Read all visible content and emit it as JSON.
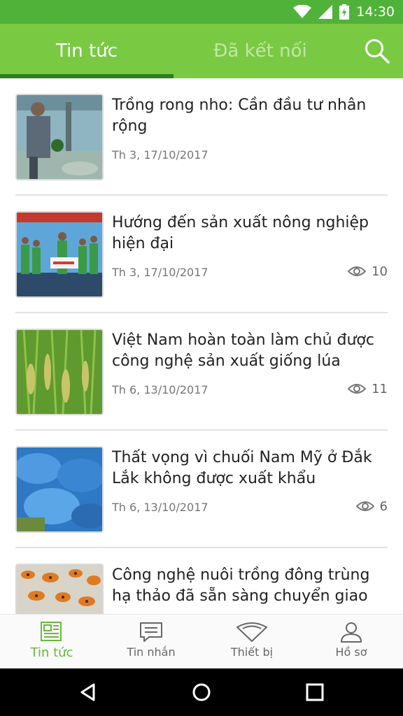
{
  "status_bar": {
    "time": "14:30"
  },
  "tabs": [
    {
      "label": "Tin tức",
      "active": true
    },
    {
      "label": "Đã kết nối",
      "active": false
    }
  ],
  "colors": {
    "status_bar": "#51b23a",
    "app_bar": "#7ac943",
    "tab_indicator": "#2e7d1f",
    "active_nav": "#6ab83c"
  },
  "articles": [
    {
      "title": "Trồng rong nho: Cần đầu tư nhân rộng",
      "date": "Th 3, 17/10/2017",
      "views": ""
    },
    {
      "title": "Hướng đến sản xuất nông nghiệp hiện đại",
      "date": "Th 3, 17/10/2017",
      "views": "10"
    },
    {
      "title": "Việt Nam hoàn toàn làm chủ được công nghệ sản xuất giống lúa",
      "date": "Th 6, 13/10/2017",
      "views": "11"
    },
    {
      "title": "Thất vọng vì chuối Nam Mỹ ở Đắk Lắk không được xuất khẩu",
      "date": "Th 6, 13/10/2017",
      "views": "6"
    },
    {
      "title": "Công nghệ nuôi trồng đông trùng hạ thảo đã sẵn sàng chuyển giao",
      "date": "",
      "views": ""
    }
  ],
  "bottom_nav": [
    {
      "label": "Tin tức",
      "icon": "newspaper-icon",
      "active": true
    },
    {
      "label": "Tin nhắn",
      "icon": "chat-icon",
      "active": false
    },
    {
      "label": "Thiết bị",
      "icon": "device-icon",
      "active": false
    },
    {
      "label": "Hồ sơ",
      "icon": "profile-icon",
      "active": false
    }
  ]
}
